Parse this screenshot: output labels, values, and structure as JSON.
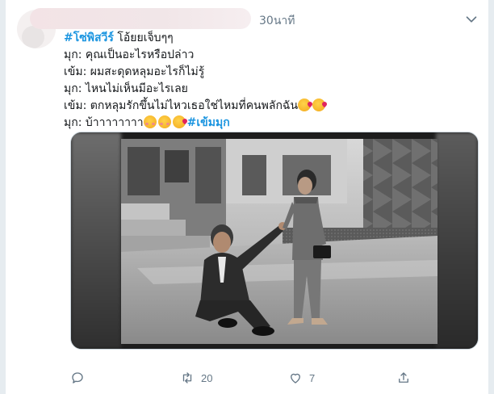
{
  "tweet": {
    "timestamp": "30นาที",
    "lines": {
      "l1_hashtag": "#โซ่พิสวีร์",
      "l1_text": " โอ้ยยเจ็บๆๆ",
      "l2": "มุก: คุณเป็นอะไรหรือปล่าว",
      "l3": "เข้ม: ผมสะดุดหลุมอะไรก็ไม่รู้",
      "l4": "มุก: ไหนไม่เห็นมีอะไรเลย",
      "l5": "เข้ม: ตกหลุมรักขึ้นไม่ไหวเธอใช่ไหมที่คนพลักฉัน",
      "l6_text": "มุก: บ้าาาาาาาา",
      "l6_hashtag": "#เข้มมุก"
    },
    "emojis": {
      "line5": [
        "kissing-heart",
        "kissing-heart"
      ],
      "line6": [
        "smiling-blush",
        "smiling-blush",
        "kissing-heart"
      ]
    }
  },
  "actions": {
    "reply_count": "",
    "retweet_count": "20",
    "like_count": "7"
  },
  "colors": {
    "hashtag": "#1b95e0",
    "secondary_text": "#657786",
    "background": "#e6ecf0"
  },
  "icons": [
    "caret-down-icon",
    "reply-icon",
    "retweet-icon",
    "like-icon",
    "share-icon"
  ]
}
